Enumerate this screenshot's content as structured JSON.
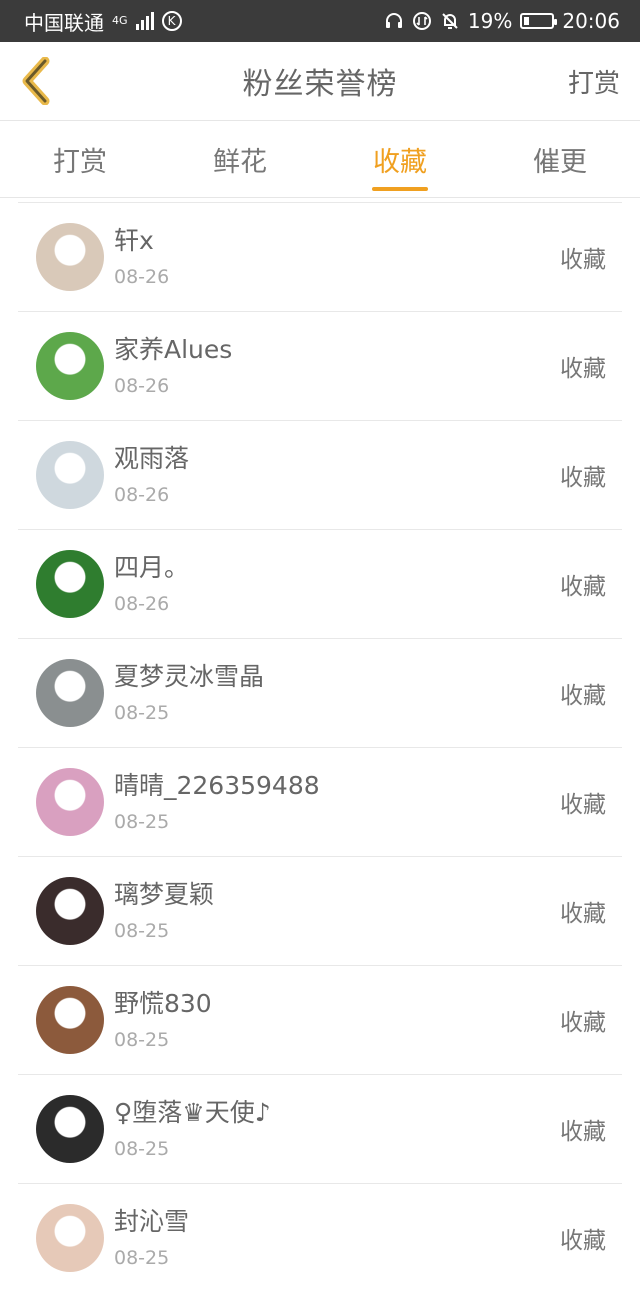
{
  "status_bar": {
    "carrier": "中国联通",
    "network": "4G",
    "battery_percent": "19%",
    "battery_level": 0.19,
    "time": "20:06",
    "icons": [
      "signal-icon",
      "k-app-icon",
      "headset-icon",
      "data-icon",
      "mute-bell-icon",
      "battery-icon"
    ]
  },
  "header": {
    "back_icon": "chevron-left-icon",
    "title": "粉丝荣誉榜",
    "right_action": "打赏"
  },
  "tabs": [
    {
      "label": "打赏",
      "active": false
    },
    {
      "label": "鲜花",
      "active": false
    },
    {
      "label": "收藏",
      "active": true
    },
    {
      "label": "催更",
      "active": false
    }
  ],
  "accent_color": "#f0a020",
  "list": [
    {
      "name": "轩x",
      "date": "08-26",
      "action": "收藏",
      "avatar_color": "#d9c9b9"
    },
    {
      "name": "家养Alues",
      "date": "08-26",
      "action": "收藏",
      "avatar_color": "#5da84b"
    },
    {
      "name": "观雨落",
      "date": "08-26",
      "action": "收藏",
      "avatar_color": "#cfd8de"
    },
    {
      "name": "四月。",
      "date": "08-26",
      "action": "收藏",
      "avatar_color": "#2f7d2f"
    },
    {
      "name": "夏梦灵冰雪晶",
      "date": "08-25",
      "action": "收藏",
      "avatar_color": "#8a8f90"
    },
    {
      "name": "晴晴_226359488",
      "date": "08-25",
      "action": "收藏",
      "avatar_color": "#d9a0c0"
    },
    {
      "name": "璃梦夏颖",
      "date": "08-25",
      "action": "收藏",
      "avatar_color": "#3a2c2c"
    },
    {
      "name": "野慌830",
      "date": "08-25",
      "action": "收藏",
      "avatar_color": "#8c5a3c"
    },
    {
      "name": "♀堕落♛天使♪",
      "date": "08-25",
      "action": "收藏",
      "avatar_color": "#2b2b2b"
    },
    {
      "name": "封沁雪",
      "date": "08-25",
      "action": "收藏",
      "avatar_color": "#e6c9b8"
    }
  ]
}
